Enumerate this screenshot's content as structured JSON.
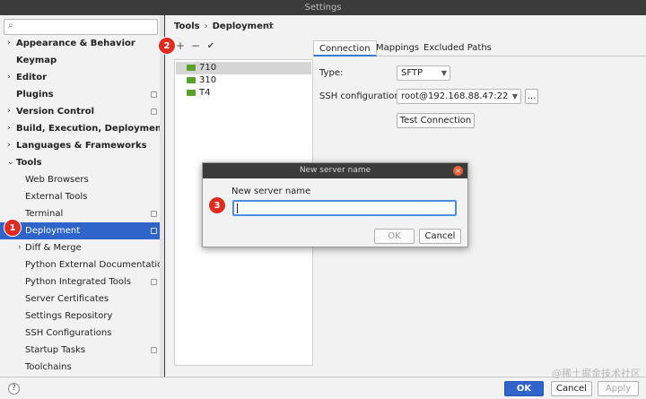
{
  "window": {
    "title": "Settings"
  },
  "sidebar": {
    "items": [
      {
        "label": "Appearance & Behavior",
        "arrow": "›",
        "bold": true,
        "indent": 0,
        "badge": false,
        "selected": false
      },
      {
        "label": "Keymap",
        "arrow": "",
        "bold": true,
        "indent": 0,
        "badge": false,
        "selected": false
      },
      {
        "label": "Editor",
        "arrow": "›",
        "bold": true,
        "indent": 0,
        "badge": false,
        "selected": false
      },
      {
        "label": "Plugins",
        "arrow": "",
        "bold": true,
        "indent": 0,
        "badge": true,
        "selected": false
      },
      {
        "label": "Version Control",
        "arrow": "›",
        "bold": true,
        "indent": 0,
        "badge": true,
        "selected": false
      },
      {
        "label": "Build, Execution, Deployment",
        "arrow": "›",
        "bold": true,
        "indent": 0,
        "badge": false,
        "selected": false
      },
      {
        "label": "Languages & Frameworks",
        "arrow": "›",
        "bold": true,
        "indent": 0,
        "badge": false,
        "selected": false
      },
      {
        "label": "Tools",
        "arrow": "⌄",
        "bold": true,
        "indent": 0,
        "badge": false,
        "selected": false
      },
      {
        "label": "Web Browsers",
        "arrow": "",
        "bold": false,
        "indent": 1,
        "badge": false,
        "selected": false
      },
      {
        "label": "External Tools",
        "arrow": "",
        "bold": false,
        "indent": 1,
        "badge": false,
        "selected": false
      },
      {
        "label": "Terminal",
        "arrow": "",
        "bold": false,
        "indent": 1,
        "badge": true,
        "selected": false
      },
      {
        "label": "Deployment",
        "arrow": "",
        "bold": false,
        "indent": 1,
        "badge": true,
        "selected": true
      },
      {
        "label": "Diff & Merge",
        "arrow": "›",
        "bold": false,
        "indent": 1,
        "badge": false,
        "selected": false
      },
      {
        "label": "Python External Documentation",
        "arrow": "",
        "bold": false,
        "indent": 1,
        "badge": false,
        "selected": false
      },
      {
        "label": "Python Integrated Tools",
        "arrow": "",
        "bold": false,
        "indent": 1,
        "badge": true,
        "selected": false
      },
      {
        "label": "Server Certificates",
        "arrow": "",
        "bold": false,
        "indent": 1,
        "badge": false,
        "selected": false
      },
      {
        "label": "Settings Repository",
        "arrow": "",
        "bold": false,
        "indent": 1,
        "badge": false,
        "selected": false
      },
      {
        "label": "SSH Configurations",
        "arrow": "",
        "bold": false,
        "indent": 1,
        "badge": false,
        "selected": false
      },
      {
        "label": "Startup Tasks",
        "arrow": "",
        "bold": false,
        "indent": 1,
        "badge": true,
        "selected": false
      },
      {
        "label": "Toolchains",
        "arrow": "",
        "bold": false,
        "indent": 1,
        "badge": false,
        "selected": false
      }
    ]
  },
  "breadcrumb": {
    "parent": "Tools",
    "separator": "›",
    "current": "Deployment"
  },
  "toolbar": {
    "add": "+",
    "remove": "−",
    "check": "✔"
  },
  "servers": [
    "710",
    "310",
    "T4"
  ],
  "tabs": [
    "Connection",
    "Mappings",
    "Excluded Paths"
  ],
  "connection": {
    "type_label": "Type:",
    "type_value": "SFTP",
    "ssh_label": "SSH configuration:",
    "ssh_value": "root@192.168.88.47:22",
    "browse_label": "...",
    "test_label": "Test Connection"
  },
  "dialog": {
    "title": "New server name",
    "label": "New server name",
    "value": "",
    "ok": "OK",
    "cancel": "Cancel",
    "close_glyph": "×"
  },
  "markers": [
    "1",
    "2",
    "3"
  ],
  "footer": {
    "help": "?",
    "ok": "OK",
    "cancel": "Cancel",
    "apply": "Apply"
  },
  "watermark": "@稀土掘金技术社区",
  "colors": {
    "selection": "#2f65ca",
    "marker": "#e02b22",
    "server_icon": "#5aa02c"
  }
}
